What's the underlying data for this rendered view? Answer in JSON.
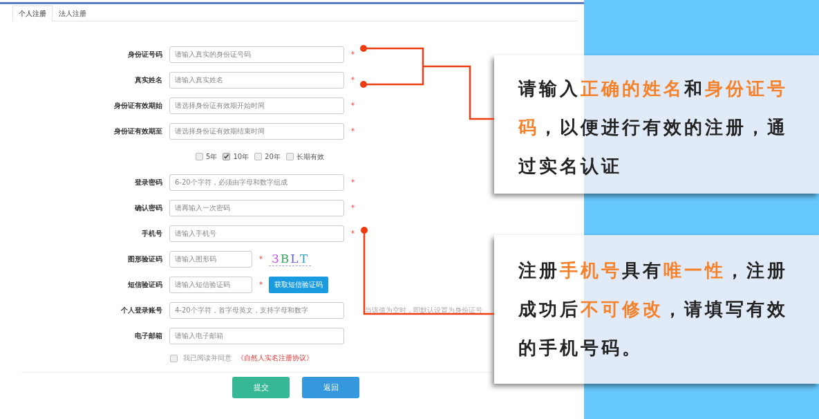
{
  "tabs": [
    {
      "label": "个人注册",
      "selected": true
    },
    {
      "label": "法人注册",
      "selected": false
    }
  ],
  "fields": [
    {
      "kind": "text",
      "label": "身份证号码",
      "placeholder": "请输入真实的身份证号码",
      "required_mark": "*"
    },
    {
      "kind": "text",
      "label": "真实姓名",
      "placeholder": "请输入真实姓名",
      "required_mark": "*"
    },
    {
      "kind": "text",
      "label": "身份证有效期始",
      "placeholder": "请选择身份证有效期开始时间",
      "required_mark": "*"
    },
    {
      "kind": "text",
      "label": "身份证有效期至",
      "placeholder": "请选择身份证有效期结束时间",
      "required_mark": "*"
    },
    {
      "kind": "options",
      "options": [
        {
          "label": "5年",
          "checked": false
        },
        {
          "label": "10年",
          "checked": true
        },
        {
          "label": "20年",
          "checked": false
        },
        {
          "label": "长期有效",
          "checked": false
        }
      ]
    },
    {
      "kind": "text",
      "label": "登录密码",
      "placeholder": "6-20个字符，必须由字母和数字组成",
      "required_mark": "*"
    },
    {
      "kind": "text",
      "label": "确认密码",
      "placeholder": "请再输入一次密码",
      "required_mark": "*"
    },
    {
      "kind": "text",
      "label": "手机号",
      "placeholder": "请输入手机号",
      "required_mark": "*"
    },
    {
      "kind": "captcha",
      "label": "图形验证码",
      "placeholder": "请输入图形码",
      "required_mark": "*",
      "captcha_text": "3BLT"
    },
    {
      "kind": "sms",
      "label": "短信验证码",
      "placeholder": "请输入短信验证码",
      "required_mark": "*",
      "button": "获取短信验证码"
    },
    {
      "kind": "hint",
      "label": "个人登录账号",
      "placeholder": "4-20个字符，首字母英文，支持字母和数字",
      "hint": "当该值为空时，即默认设置为身份证号"
    },
    {
      "kind": "text",
      "label": "电子邮箱",
      "placeholder": "请输入电子邮箱"
    }
  ],
  "agreement": {
    "checked": false,
    "text": "我已阅读并同意",
    "link": "《自然人实名注册协议》"
  },
  "buttons": [
    {
      "label": "提交",
      "kind": "primary"
    },
    {
      "label": "返回",
      "kind": "secondary"
    }
  ],
  "callouts": [
    {
      "segments": [
        {
          "text": "请输入",
          "highlight": false
        },
        {
          "text": "正确的姓名",
          "highlight": true
        },
        {
          "text": "和",
          "highlight": false
        },
        {
          "text": "身份证号码",
          "highlight": true
        },
        {
          "text": "，以便进行有效的注册，通过实名认证",
          "highlight": false
        }
      ]
    },
    {
      "segments": [
        {
          "text": "注册",
          "highlight": false
        },
        {
          "text": "手机号",
          "highlight": true
        },
        {
          "text": "具有",
          "highlight": false
        },
        {
          "text": "唯一性",
          "highlight": true
        },
        {
          "text": "，注册成功后",
          "highlight": false
        },
        {
          "text": "不可修改",
          "highlight": true
        },
        {
          "text": "，请填写有效的手机号码。",
          "highlight": false
        }
      ]
    }
  ]
}
